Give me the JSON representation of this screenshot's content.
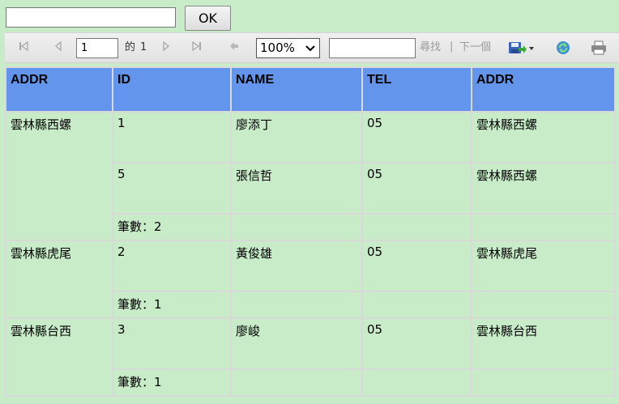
{
  "top": {
    "input_value": "",
    "ok_label": "OK"
  },
  "toolbar": {
    "first_icon": "first-page-icon",
    "prev_icon": "previous-page-icon",
    "page_value": "1",
    "of_label": "的",
    "total_pages": "1",
    "next_icon": "next-page-icon",
    "last_icon": "last-page-icon",
    "back_icon": "back-icon",
    "zoom_value": "100%",
    "find_value": "",
    "find_label": "尋找",
    "separator": "|",
    "next_label": "下一個",
    "export_icon": "save-export-icon",
    "refresh_icon": "refresh-icon",
    "print_icon": "print-icon"
  },
  "table": {
    "headers": [
      "ADDR",
      "ID",
      "NAME",
      "TEL",
      "ADDR"
    ],
    "groups": [
      {
        "addr": "雲林縣西螺",
        "rows": [
          {
            "id": "1",
            "name": "廖添丁",
            "tel": "05",
            "addr": "雲林縣西螺"
          },
          {
            "id": "5",
            "name": "張信哲",
            "tel": "05",
            "addr": "雲林縣西螺"
          }
        ],
        "count_label": "筆數：2"
      },
      {
        "addr": "雲林縣虎尾",
        "rows": [
          {
            "id": "2",
            "name": "黃俊雄",
            "tel": "05",
            "addr": "雲林縣虎尾"
          }
        ],
        "count_label": "筆數：1"
      },
      {
        "addr": "雲林縣台西",
        "rows": [
          {
            "id": "3",
            "name": "廖峻",
            "tel": "05",
            "addr": "雲林縣台西"
          }
        ],
        "count_label": "筆數：1"
      }
    ]
  },
  "colors": {
    "background": "#c8ecc8",
    "header": "#6495ed",
    "count_text": "#e00000"
  }
}
